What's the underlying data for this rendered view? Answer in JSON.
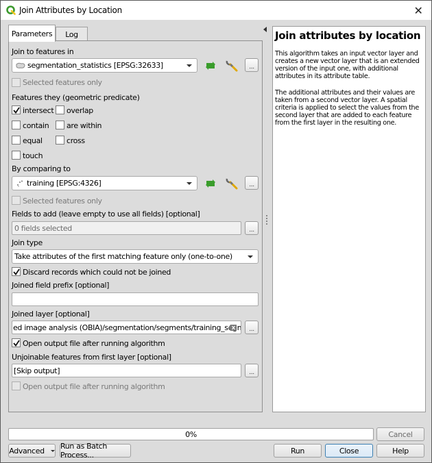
{
  "window": {
    "title": "Join Attributes by Location",
    "close_icon": "close-icon"
  },
  "tabs": [
    {
      "label": "Parameters",
      "active": true
    },
    {
      "label": "Log",
      "active": false
    }
  ],
  "params": {
    "join_to_label": "Join to features in",
    "join_to_value": "segmentation_statistics [EPSG:32633]",
    "join_to_selected_only": {
      "label": "Selected features only",
      "checked": false,
      "enabled": false
    },
    "predicate_label": "Features they (geometric predicate)",
    "predicates": [
      {
        "label": "intersect",
        "checked": true
      },
      {
        "label": "overlap",
        "checked": false
      },
      {
        "label": "contain",
        "checked": false
      },
      {
        "label": "are within",
        "checked": false
      },
      {
        "label": "equal",
        "checked": false
      },
      {
        "label": "cross",
        "checked": false
      },
      {
        "label": "touch",
        "checked": false
      }
    ],
    "compare_label": "By comparing to",
    "compare_value": "training [EPSG:4326]",
    "compare_selected_only": {
      "label": "Selected features only",
      "checked": false,
      "enabled": false
    },
    "fields_label": "Fields to add (leave empty to use all fields) [optional]",
    "fields_value": "0 fields selected",
    "join_type_label": "Join type",
    "join_type_value": "Take attributes of the first matching feature only (one-to-one)",
    "discard": {
      "label": "Discard records which could not be joined",
      "checked": true
    },
    "prefix_label": "Joined field prefix [optional]",
    "prefix_value": "",
    "joined_layer_label": "Joined layer [optional]",
    "joined_layer_value": "ed image analysis (OBIA)/segmentation/segments/training_segments.shp",
    "open_output": {
      "label": "Open output file after running algorithm",
      "checked": true
    },
    "unjoinable_label": "Unjoinable features from first layer [optional]",
    "unjoinable_value": "[Skip output]",
    "open_unjoinable": {
      "label": "Open output file after running algorithm",
      "checked": false,
      "enabled": false
    },
    "dots_label": "..."
  },
  "help": {
    "title": "Join attributes by location",
    "para1": "This algorithm takes an input vector layer and creates a new vector layer that is an extended version of the input one, with additional attributes in its attribute table.",
    "para2": "The additional attributes and their values are taken from a second vector layer. A spatial criteria is applied to select the values from the second layer that are added to each feature from the first layer in the resulting one."
  },
  "footer": {
    "progress_percent": 0,
    "progress_label": "0%",
    "cancel": "Cancel",
    "advanced": "Advanced",
    "batch": "Run as Batch Process...",
    "run": "Run",
    "close": "Close",
    "help": "Help"
  },
  "colors": {
    "qgis_green": "#3c9a2e",
    "qgis_yellow": "#f0c419",
    "refresh_green": "#3a9d2c",
    "focus_blue": "#3c7fb1"
  }
}
